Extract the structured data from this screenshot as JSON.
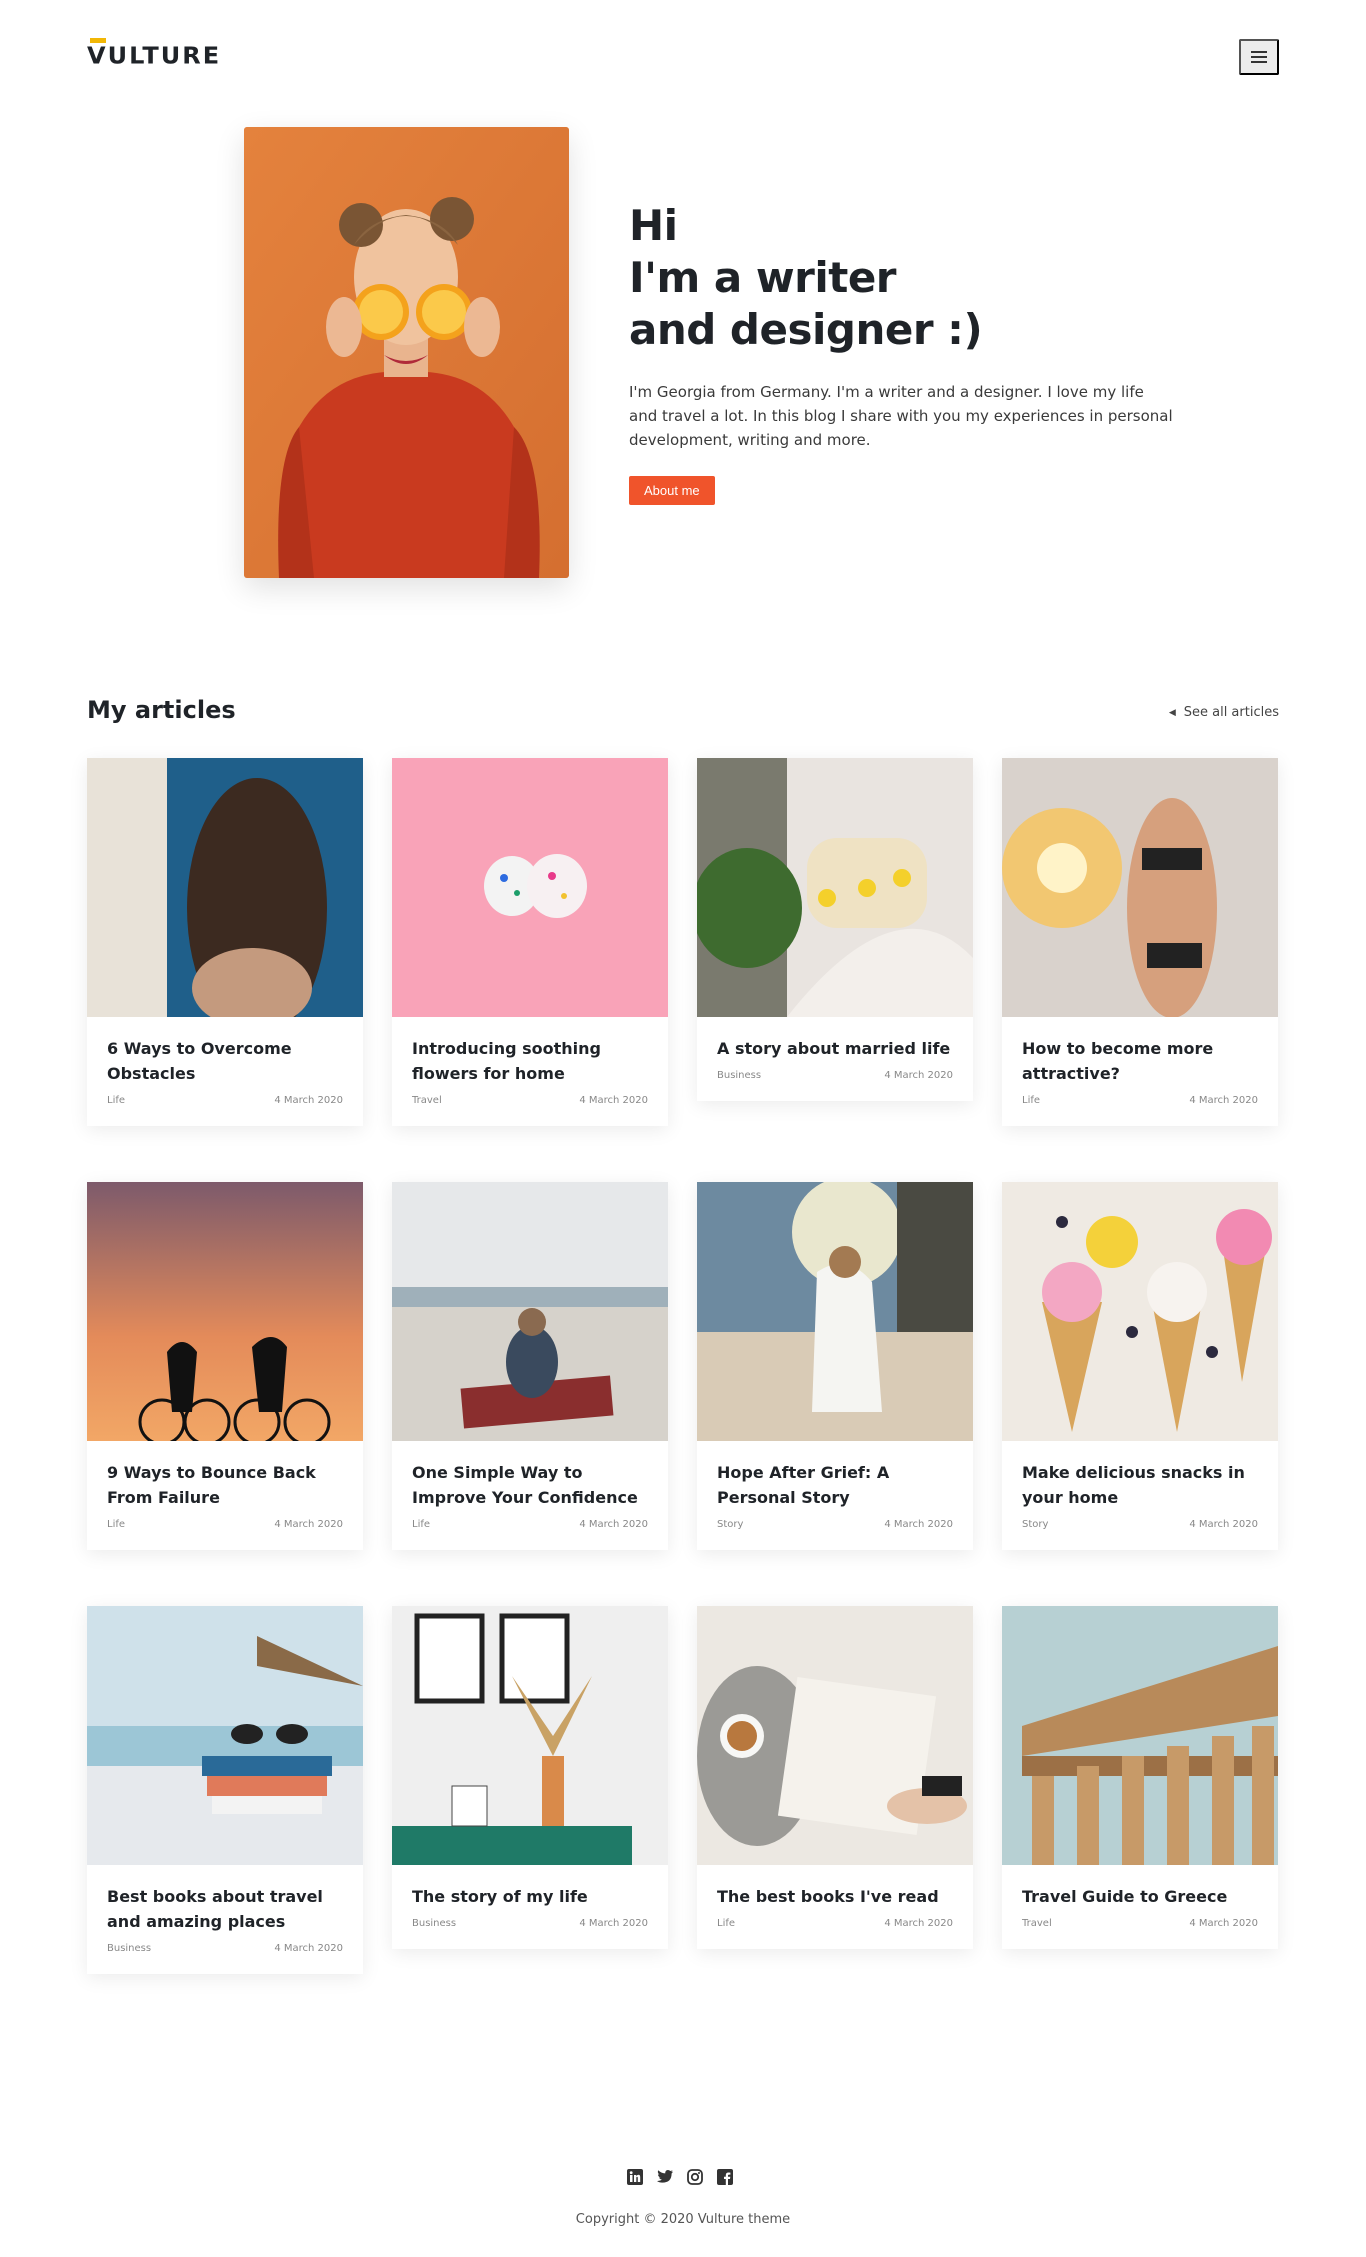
{
  "header": {
    "logo": "VULTURE",
    "menu_icon": "hamburger-menu-icon"
  },
  "hero": {
    "heading": [
      "Hi",
      "I'm a writer",
      "and designer :)"
    ],
    "description": "I'm Georgia from Germany. I'm a writer and a designer. I love my life and travel a lot. In this blog I share with you my experiences in personal development, writing and more.",
    "button_label": "About me"
  },
  "articles": {
    "title": "My articles",
    "see_all_label": "See all articles",
    "items": [
      {
        "title": "6 Ways to Overcome Obstacles",
        "category": "Life",
        "date": "4 March 2020"
      },
      {
        "title": "Introducing soothing flowers for home",
        "category": "Travel",
        "date": "4 March 2020"
      },
      {
        "title": "A story about married life",
        "category": "Business",
        "date": "4 March 2020"
      },
      {
        "title": "How to become more attractive?",
        "category": "Life",
        "date": "4 March 2020"
      },
      {
        "title": "9 Ways to Bounce Back From Failure",
        "category": "Life",
        "date": "4 March 2020"
      },
      {
        "title": "One Simple Way to Improve Your Confidence",
        "category": "Life",
        "date": "4 March 2020"
      },
      {
        "title": "Hope After Grief: A Personal Story",
        "category": "Story",
        "date": "4 March 2020"
      },
      {
        "title": "Make delicious snacks in your home",
        "category": "Story",
        "date": "4 March 2020"
      },
      {
        "title": "Best books about travel and amazing places",
        "category": "Business",
        "date": "4 March 2020"
      },
      {
        "title": "The story of my life",
        "category": "Business",
        "date": "4 March 2020"
      },
      {
        "title": "The best books I've read",
        "category": "Life",
        "date": "4 March 2020"
      },
      {
        "title": "Travel Guide to Greece",
        "category": "Travel",
        "date": "4 March 2020"
      }
    ]
  },
  "footer": {
    "social_icons": [
      "linkedin-icon",
      "twitter-icon",
      "instagram-icon",
      "facebook-icon"
    ],
    "copyright": "Copyright © 2020 Vulture theme"
  },
  "colors": {
    "accent": "#f0542b",
    "logo_bar": "#f2b705",
    "text_dark": "#1f2328"
  }
}
